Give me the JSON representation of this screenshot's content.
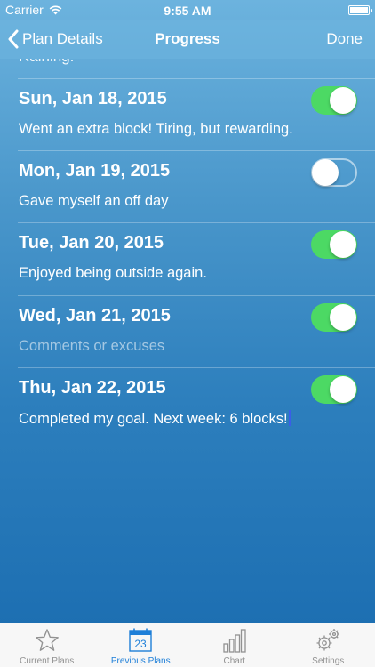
{
  "status_bar": {
    "carrier": "Carrier",
    "time": "9:55 AM"
  },
  "nav": {
    "back_label": "Plan Details",
    "title": "Progress",
    "done_label": "Done"
  },
  "clipped_text": "Raining.",
  "entries": [
    {
      "date": "Sun, Jan 18, 2015",
      "comment": "Went an extra block! Tiring, but rewarding.",
      "completed": true
    },
    {
      "date": "Mon, Jan 19, 2015",
      "comment": "Gave myself an off day",
      "completed": false
    },
    {
      "date": "Tue, Jan 20, 2015",
      "comment": "Enjoyed being outside again.",
      "completed": true
    },
    {
      "date": "Wed, Jan 21, 2015",
      "comment": "",
      "placeholder": "Comments or excuses",
      "completed": true
    },
    {
      "date": "Thu, Jan 22, 2015",
      "comment": "Completed my goal. Next week: 6 blocks!",
      "completed": true
    }
  ],
  "tabs": [
    {
      "label": "Current Plans",
      "icon": "star-icon",
      "active": false
    },
    {
      "label": "Previous Plans",
      "icon": "calendar-icon",
      "calendar_day": "23",
      "active": true
    },
    {
      "label": "Chart",
      "icon": "bar-chart-icon",
      "active": false
    },
    {
      "label": "Settings",
      "icon": "gears-icon",
      "active": false
    }
  ],
  "colors": {
    "switch_on": "#4cd964",
    "tab_active": "#1e7fd8",
    "tab_inactive": "#929292"
  }
}
